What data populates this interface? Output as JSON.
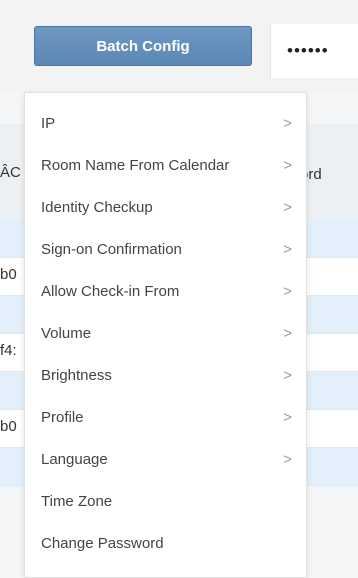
{
  "toolbar": {
    "batch_config_label": "Batch Config",
    "password_mask": "••••••"
  },
  "table": {
    "header_left": "ÂC",
    "header_right": "ord",
    "rows": [
      {
        "cell": ""
      },
      {
        "cell": "b0"
      },
      {
        "cell": ""
      },
      {
        "cell": "f4:"
      },
      {
        "cell": ""
      },
      {
        "cell": "b0"
      },
      {
        "cell": ""
      }
    ]
  },
  "menu": {
    "items": [
      {
        "label": "IP",
        "has_submenu": true
      },
      {
        "label": "Room Name From Calendar",
        "has_submenu": true
      },
      {
        "label": "Identity Checkup",
        "has_submenu": true
      },
      {
        "label": "Sign-on Confirmation",
        "has_submenu": true
      },
      {
        "label": "Allow Check-in From",
        "has_submenu": true
      },
      {
        "label": "Volume",
        "has_submenu": true
      },
      {
        "label": "Brightness",
        "has_submenu": true
      },
      {
        "label": "Profile",
        "has_submenu": true
      },
      {
        "label": "Language",
        "has_submenu": true
      },
      {
        "label": "Time Zone",
        "has_submenu": false
      },
      {
        "label": "Change Password",
        "has_submenu": false
      }
    ],
    "submenu_indicator": ">"
  },
  "colors": {
    "button": "#5b87b5",
    "row_highlight": "#e3f0fb"
  }
}
